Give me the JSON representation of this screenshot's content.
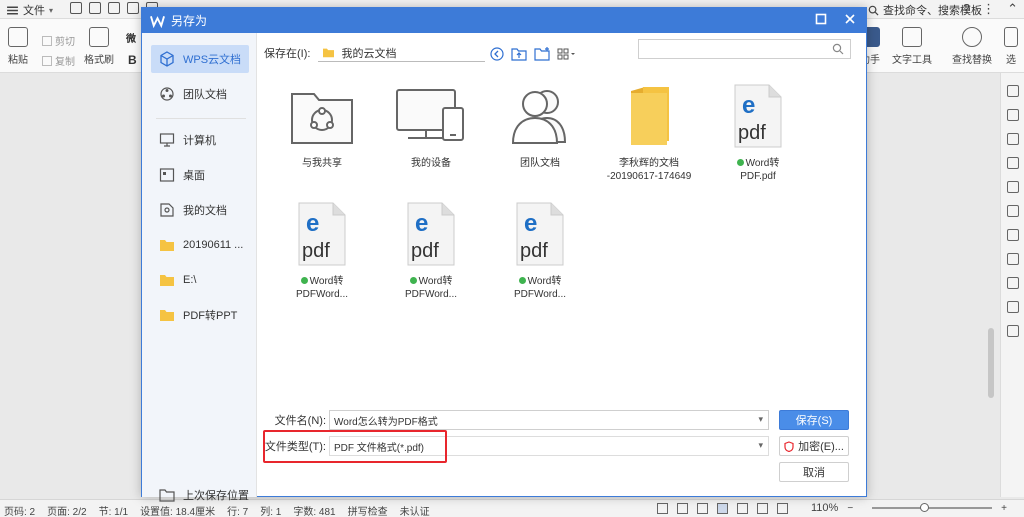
{
  "app": {
    "menu_file": "文件",
    "search_hint": "查找命令、搜索模板",
    "ribbon": {
      "paste": "粘贴",
      "cut": "剪切",
      "copy": "复制",
      "format_painter": "格式刷",
      "font_bold": "B",
      "font_name": "微",
      "assistant": "助手",
      "text_tools": "文字工具",
      "find_replace": "查找替换",
      "select": "选"
    },
    "status": {
      "page_num": "页码: 2",
      "page": "页面: 2/2",
      "section": "节: 1/1",
      "setting": "设置值: 18.4厘米",
      "row": "行: 7",
      "col": "列: 1",
      "words": "字数: 481",
      "spell": "拼写检查",
      "cert": "未认证",
      "zoom": "110%"
    }
  },
  "dialog": {
    "title": "另存为",
    "sidebar": {
      "items": [
        {
          "label": "WPS云文档",
          "icon": "cloud-cube-icon",
          "active": true
        },
        {
          "label": "团队文档",
          "icon": "team-icon",
          "active": false
        },
        {
          "label": "计算机",
          "icon": "computer-icon",
          "active": false
        },
        {
          "label": "桌面",
          "icon": "desktop-icon",
          "active": false
        },
        {
          "label": "我的文档",
          "icon": "my-docs-icon",
          "active": false
        },
        {
          "label": "20190611 ...",
          "icon": "folder-icon",
          "active": false
        },
        {
          "label": "E:\\",
          "icon": "folder-icon",
          "active": false
        },
        {
          "label": "PDF转PPT",
          "icon": "folder-icon",
          "active": false
        }
      ],
      "recent_location": "上次保存位置"
    },
    "save_in_label": "保存在(I):",
    "save_in_value": "我的云文档",
    "search_placeholder": "",
    "files": [
      {
        "name": "与我共享",
        "type": "shared-folder",
        "synced": false
      },
      {
        "name": "我的设备",
        "type": "device",
        "synced": false
      },
      {
        "name": "团队文档",
        "type": "team",
        "synced": false
      },
      {
        "name": "李秋辉的文档",
        "name2": "-20190617-174649",
        "type": "folder",
        "synced": false
      },
      {
        "name": "Word转",
        "name2": "PDF.pdf",
        "type": "pdf",
        "synced": true
      },
      {
        "name": "Word转",
        "name2": "PDFWord...",
        "type": "pdf",
        "synced": true
      },
      {
        "name": "Word转",
        "name2": "PDFWord...",
        "type": "pdf",
        "synced": true
      },
      {
        "name": "Word转",
        "name2": "PDFWord...",
        "type": "pdf",
        "synced": true
      }
    ],
    "filename_label": "文件名(N):",
    "filename_value": "Word怎么转为PDF格式",
    "filetype_label": "文件类型(T):",
    "filetype_value": "PDF 文件格式(*.pdf)",
    "save_button": "保存(S)",
    "encrypt_button": "加密(E)...",
    "cancel_button": "取消",
    "colors": {
      "accent": "#3d7bd8",
      "highlight": "#e8262d",
      "folder": "#f5c342",
      "pdf_blue": "#1f6fc5"
    }
  }
}
